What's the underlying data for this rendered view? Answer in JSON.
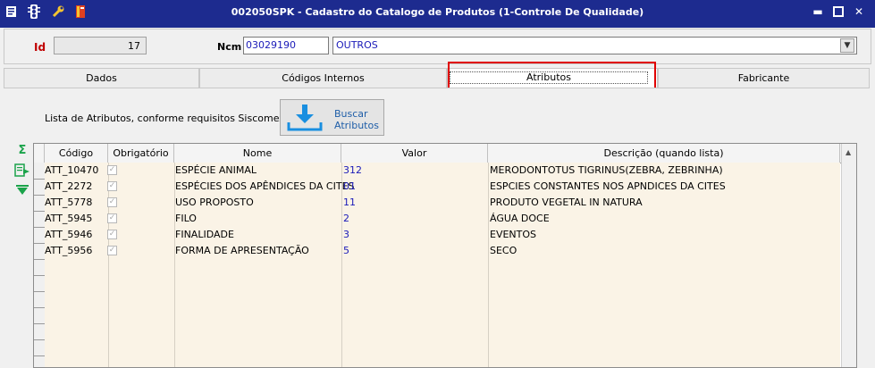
{
  "window": {
    "title": "002050SPK - Cadastro do Catalogo de Produtos (1-Controle De Qualidade)",
    "toolbar_icons": [
      "menu-icon",
      "traffic-light-icon",
      "wrench-icon",
      "book-icon"
    ],
    "controls": [
      "minimize-icon",
      "restore-icon",
      "close-icon"
    ]
  },
  "header": {
    "id_label": "Id",
    "id_value": "17",
    "ncm_label": "Ncm",
    "ncm_code": "03029190",
    "ncm_description": "OUTROS"
  },
  "tabs": [
    {
      "label": "Dados",
      "active": false
    },
    {
      "label": "Códigos Internos",
      "active": false
    },
    {
      "label": "Atributos",
      "active": true
    },
    {
      "label": "Fabricante",
      "active": false
    }
  ],
  "attributes_panel": {
    "info_text": "Lista de Atributos, conforme requisitos Siscomex",
    "fetch_button_label": "Buscar Atributos",
    "side_icons": [
      "sum-icon",
      "export-icon",
      "filter-down-icon"
    ],
    "columns": [
      "Código",
      "Obrigatório",
      "Nome",
      "Valor",
      "Descrição (quando lista)"
    ],
    "rows": [
      {
        "codigo": "ATT_10470",
        "obrigatorio": true,
        "nome": "ESPÉCIE ANIMAL",
        "valor": "312",
        "descricao": "MERODONTOTUS TIGRINUS(ZEBRA, ZEBRINHA)"
      },
      {
        "codigo": "ATT_2272",
        "obrigatorio": true,
        "nome": "ESPÉCIES DOS APÊNDICES DA CITES",
        "valor": "01",
        "descricao": "ESPCIES CONSTANTES NOS APNDICES DA CITES"
      },
      {
        "codigo": "ATT_5778",
        "obrigatorio": true,
        "nome": "USO PROPOSTO",
        "valor": "11",
        "descricao": "PRODUTO VEGETAL IN NATURA"
      },
      {
        "codigo": "ATT_5945",
        "obrigatorio": true,
        "nome": "FILO",
        "valor": "2",
        "descricao": "ÁGUA DOCE"
      },
      {
        "codigo": "ATT_5946",
        "obrigatorio": true,
        "nome": "FINALIDADE",
        "valor": "3",
        "descricao": "EVENTOS"
      },
      {
        "codigo": "ATT_5956",
        "obrigatorio": true,
        "nome": "FORMA DE APRESENTAÇÃO",
        "valor": "5",
        "descricao": "SECO"
      }
    ]
  },
  "colors": {
    "titlebar": "#1d2b8f",
    "grid_body": "#faf3e6",
    "value_text": "#1a1ab8",
    "id_label": "#c00000",
    "highlight": "#e00000",
    "button_text": "#1f5ea8"
  }
}
